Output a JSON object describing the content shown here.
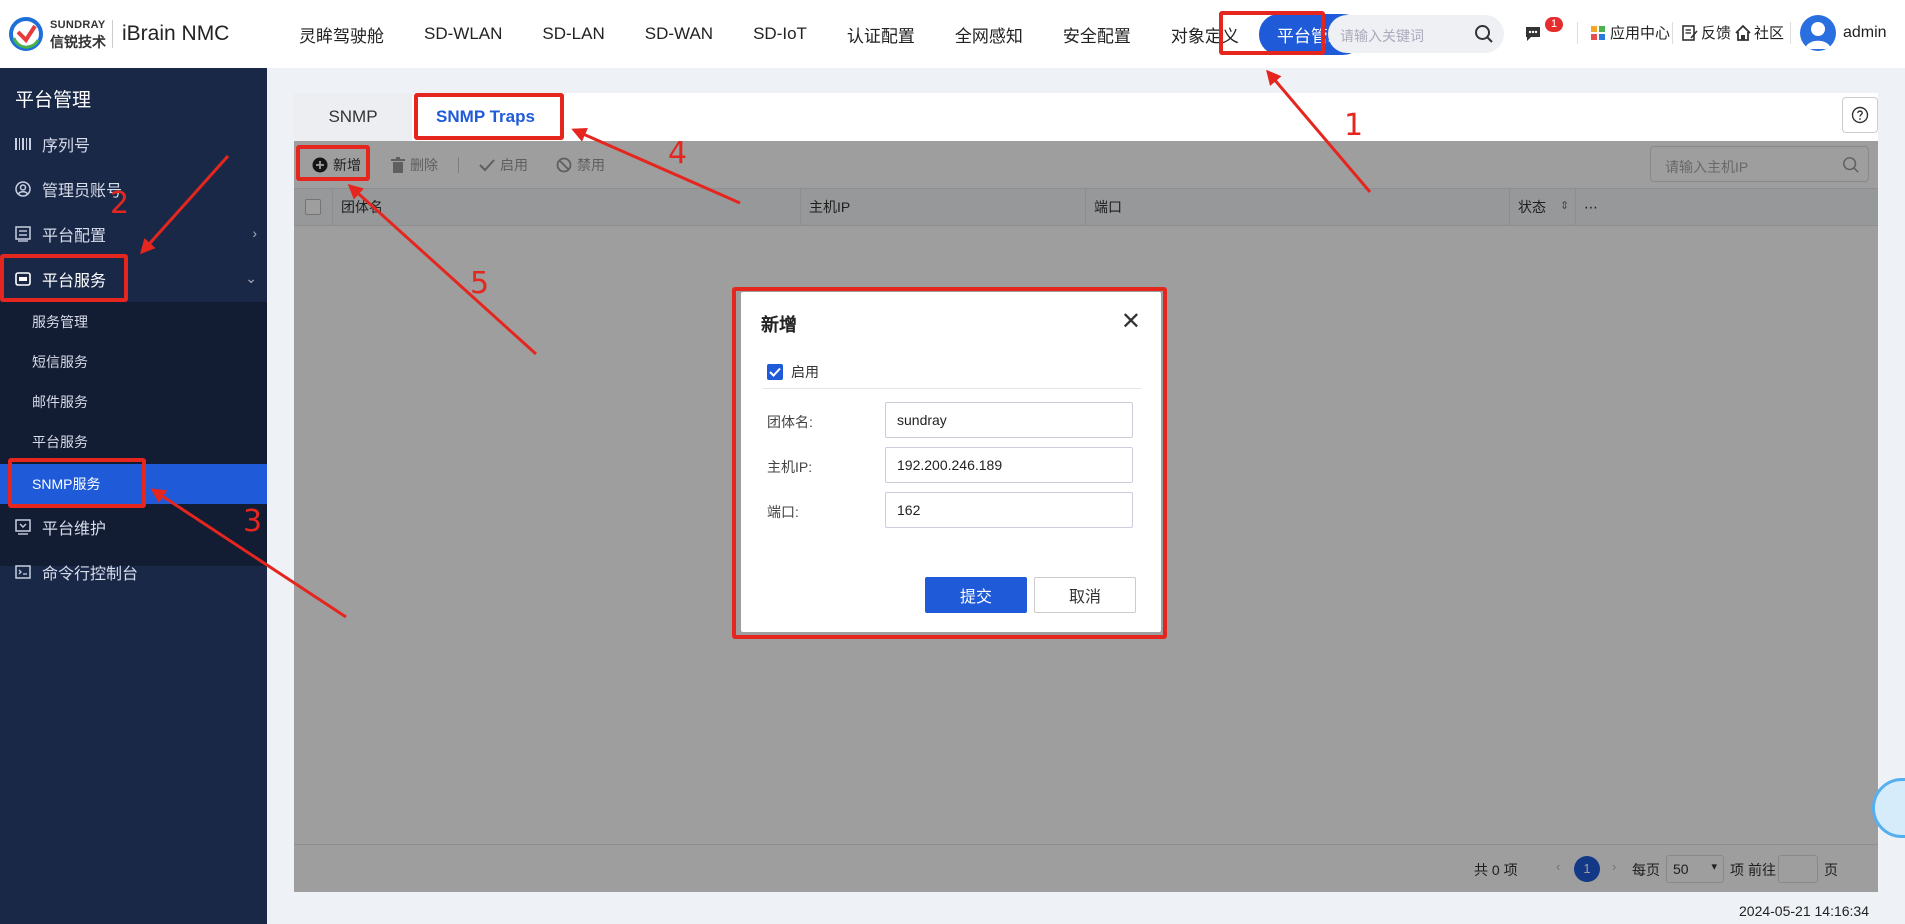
{
  "header": {
    "brand_en": "SUNDRAY",
    "brand_cn": "信锐技术",
    "product": "iBrain NMC",
    "nav": [
      "灵眸驾驶舱",
      "SD-WLAN",
      "SD-LAN",
      "SD-WAN",
      "SD-IoT",
      "认证配置",
      "全网感知",
      "安全配置",
      "对象定义",
      "平台管理"
    ],
    "search_placeholder": "请输入关键词",
    "message_badge": "1",
    "app_center": "应用中心",
    "feedback": "反馈",
    "community": "社区",
    "user": "admin"
  },
  "sidebar": {
    "title": "平台管理",
    "items": [
      "序列号",
      "管理员账号",
      "平台配置",
      "平台服务"
    ],
    "sub_items": [
      "服务管理",
      "短信服务",
      "邮件服务",
      "平台服务",
      "SNMP服务"
    ],
    "bottom_items": [
      "平台维护",
      "命令行控制台"
    ]
  },
  "tabs": [
    "SNMP",
    "SNMP Traps"
  ],
  "toolbar": {
    "add": "新增",
    "delete": "删除",
    "enable": "启用",
    "disable": "禁用",
    "ip_search_placeholder": "请输入主机IP"
  },
  "table": {
    "columns": [
      "团体名",
      "主机IP",
      "端口",
      "状态"
    ]
  },
  "pagination": {
    "total": "共 0 项",
    "current_page": "1",
    "per_page_label": "每页",
    "per_page": "50",
    "unit": "项",
    "goto": "前往",
    "page_unit": "页"
  },
  "modal": {
    "title": "新增",
    "enable_label": "启用",
    "enabled": true,
    "fields": [
      {
        "label": "团体名:",
        "value": "sundray"
      },
      {
        "label": "主机IP:",
        "value": "192.200.246.189"
      },
      {
        "label": "端口:",
        "value": "162"
      }
    ],
    "submit": "提交",
    "cancel": "取消"
  },
  "timestamp": "2024-05-21 14:16:34",
  "annotations": [
    "1",
    "2",
    "3",
    "4",
    "5"
  ],
  "colors": {
    "primary": "#1f5bd8",
    "sidebar": "#1a2847",
    "annotation": "#e5261f"
  }
}
